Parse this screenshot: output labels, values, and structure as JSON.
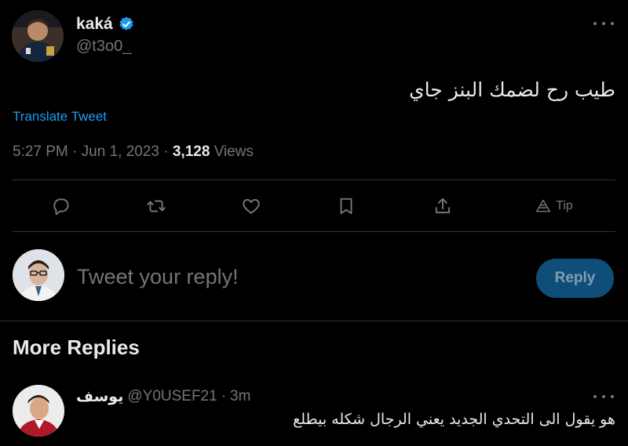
{
  "tweet": {
    "author": {
      "name": "kaká",
      "handle": "@t3o0_",
      "verified": true,
      "verified_color": "#1d9bf0"
    },
    "text": "طيب رح لضمك البنز جاي",
    "translate_label": "Translate Tweet",
    "time": "5:27 PM",
    "date": "Jun 1, 2023",
    "views_count": "3,128",
    "views_label": "Views"
  },
  "actions": {
    "reply_icon": "reply-icon",
    "retweet_icon": "retweet-icon",
    "like_icon": "like-icon",
    "bookmark_icon": "bookmark-icon",
    "share_icon": "share-icon",
    "tip_label": "Tip"
  },
  "composer": {
    "placeholder": "Tweet your reply!",
    "button_label": "Reply"
  },
  "more_replies": {
    "heading": "More Replies",
    "items": [
      {
        "name": "يوسف",
        "handle": "@Y0USEF21",
        "time": "3m",
        "text": "هو يقول الى التحدي الجديد يعني الرجال شكله بيطلع"
      }
    ]
  },
  "colors": {
    "background": "#000000",
    "accent": "#1d9bf0",
    "muted": "#71767b",
    "divider": "#2f3336",
    "reply_button_bg": "#0f4e78"
  }
}
